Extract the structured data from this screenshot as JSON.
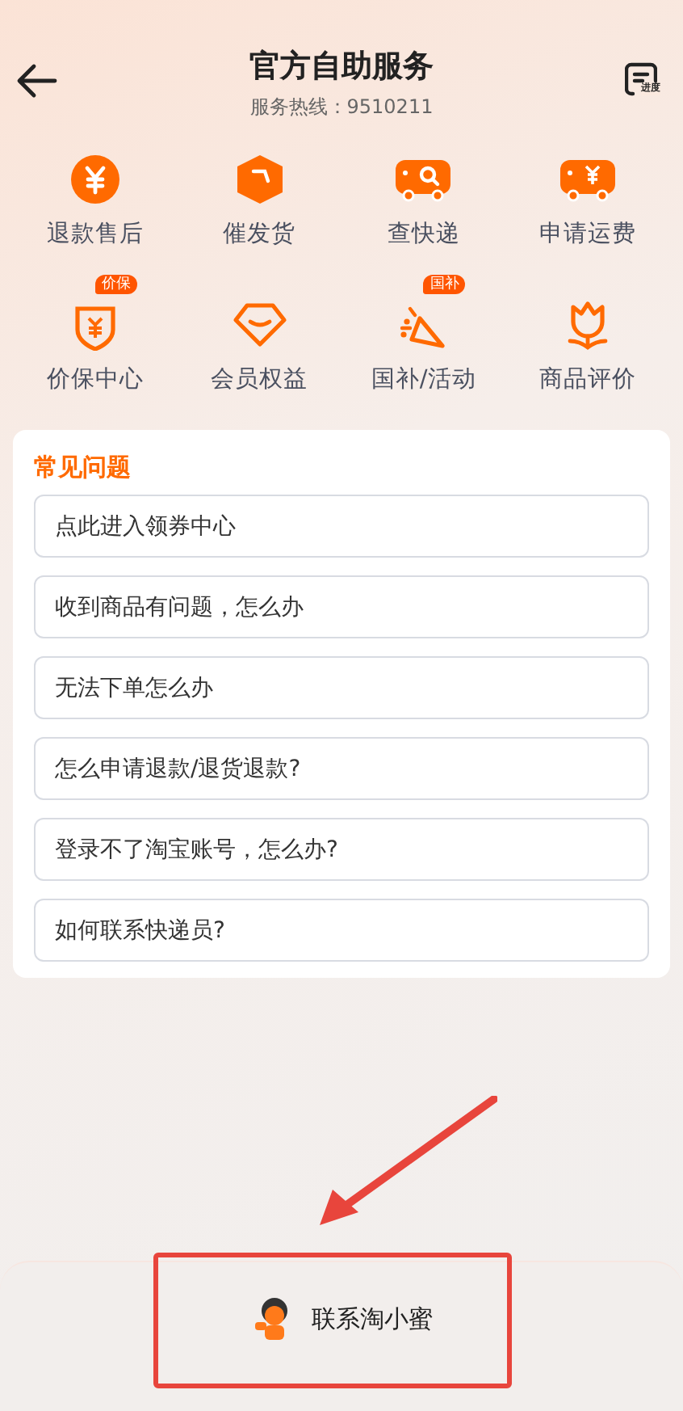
{
  "header": {
    "title": "官方自助服务",
    "hotline": "服务热线：9510211",
    "progress_badge": "进度"
  },
  "services": [
    {
      "kind": "yen",
      "label": "退款售后"
    },
    {
      "kind": "box",
      "label": "催发货"
    },
    {
      "kind": "truck-search",
      "label": "查快递"
    },
    {
      "kind": "truck-yen",
      "label": "申请运费"
    },
    {
      "kind": "shield",
      "label": "价保中心",
      "badge": "价保"
    },
    {
      "kind": "gem",
      "label": "会员权益"
    },
    {
      "kind": "party",
      "label": "国补/活动",
      "badge": "国补"
    },
    {
      "kind": "tulip",
      "label": "商品评价"
    }
  ],
  "faq": {
    "title": "常见问题",
    "items": [
      "点此进入领券中心",
      "收到商品有问题，怎么办",
      "无法下单怎么办",
      "怎么申请退款/退货退款?",
      "登录不了淘宝账号，怎么办?",
      "如何联系快递员?"
    ]
  },
  "contact": {
    "label": "联系淘小蜜"
  }
}
